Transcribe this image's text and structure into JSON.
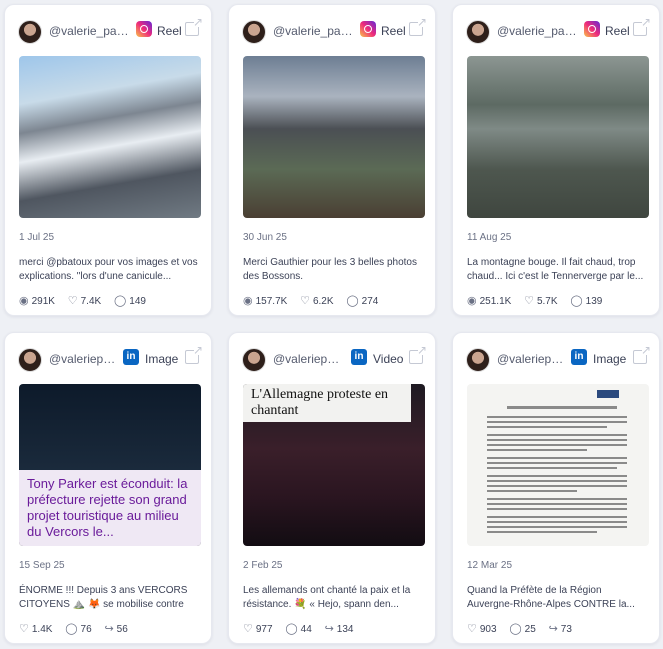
{
  "cards": [
    {
      "handle": "@valerie_pau...",
      "network": "Reel",
      "date": "1 Jul 25",
      "caption": "merci @pbatoux pour vos images et vos explications. \"lors d'une canicule...",
      "stats": [
        {
          "icon": "eye-icon",
          "value": "291K"
        },
        {
          "icon": "heart-icon",
          "value": "7.4K"
        },
        {
          "icon": "comment-icon",
          "value": "149"
        }
      ]
    },
    {
      "handle": "@valerie_pau...",
      "network": "Reel",
      "date": "30 Jun 25",
      "caption": "Merci Gauthier pour les 3 belles photos des Bossons.",
      "stats": [
        {
          "icon": "eye-icon",
          "value": "157.7K"
        },
        {
          "icon": "heart-icon",
          "value": "6.2K"
        },
        {
          "icon": "comment-icon",
          "value": "274"
        }
      ]
    },
    {
      "handle": "@valerie_pau...",
      "network": "Reel",
      "date": "11 Aug 25",
      "caption": "La montagne bouge. Il fait chaud, trop chaud... Ici c'est le Tennerverge par le...",
      "stats": [
        {
          "icon": "eye-icon",
          "value": "251.1K"
        },
        {
          "icon": "heart-icon",
          "value": "5.7K"
        },
        {
          "icon": "comment-icon",
          "value": "139"
        }
      ]
    },
    {
      "handle": "@valeriepa...",
      "network": "Image",
      "date": "15 Sep 25",
      "caption": "ÉNORME !!! Depuis 3 ans VERCORS CITOYENS ⛰️ 🦊 se mobilise contre le...",
      "image_text": "Tony Parker est éconduit: la préfecture rejette son grand projet touristique au milieu du Vercors le...",
      "stats": [
        {
          "icon": "heart-icon",
          "value": "1.4K"
        },
        {
          "icon": "comment-icon",
          "value": "76"
        },
        {
          "icon": "share-icon",
          "value": "56"
        }
      ]
    },
    {
      "handle": "@valeriepa...",
      "network": "Video",
      "date": "2 Feb 25",
      "caption": "Les allemands ont chanté la paix et la résistance. 💐 « Hejo, spann den...",
      "image_text": "L'Allemagne proteste en chantant",
      "stats": [
        {
          "icon": "heart-icon",
          "value": "977"
        },
        {
          "icon": "comment-icon",
          "value": "44"
        },
        {
          "icon": "share-icon",
          "value": "134"
        }
      ]
    },
    {
      "handle": "@valeriepa...",
      "network": "Image",
      "date": "12 Mar 25",
      "caption": "Quand la Préfète de la Région Auvergne-Rhône-Alpes CONTRE la...",
      "stats": [
        {
          "icon": "heart-icon",
          "value": "903"
        },
        {
          "icon": "comment-icon",
          "value": "25"
        },
        {
          "icon": "share-icon",
          "value": "73"
        }
      ]
    }
  ]
}
